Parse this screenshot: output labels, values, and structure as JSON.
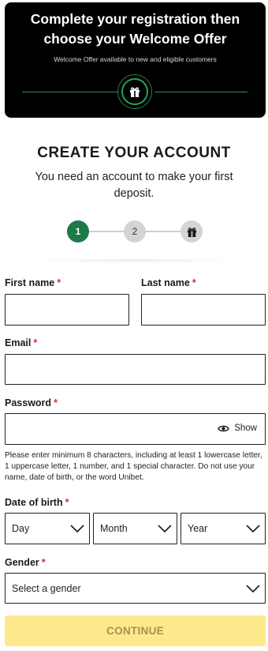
{
  "banner": {
    "title_line1": "Complete your registration then",
    "title_line2": "choose your Welcome Offer",
    "subtitle": "Welcome Offer available to new and eligible customers",
    "icon": "gift-icon",
    "accent_color": "#25a35a"
  },
  "header": {
    "title": "CREATE YOUR ACCOUNT",
    "subtitle": "You need an account to make your first deposit."
  },
  "stepper": {
    "steps": [
      {
        "label": "1",
        "state": "active"
      },
      {
        "label": "2",
        "state": "upcoming"
      },
      {
        "label": "",
        "icon": "gift-icon",
        "state": "upcoming"
      }
    ],
    "active_color": "#1e7a47"
  },
  "form": {
    "first_name": {
      "label": "First name",
      "required": "*",
      "value": "",
      "placeholder": ""
    },
    "last_name": {
      "label": "Last name",
      "required": "*",
      "value": "",
      "placeholder": ""
    },
    "email": {
      "label": "Email",
      "required": "*",
      "value": "",
      "placeholder": ""
    },
    "password": {
      "label": "Password",
      "required": "*",
      "value": "",
      "placeholder": "",
      "show_label": "Show",
      "hint": "Please enter minimum 8 characters, including at least 1 lowercase letter, 1 uppercase letter, 1 number, and 1 special character. Do not use your name, date of birth, or the word Unibet."
    },
    "dob": {
      "label": "Date of birth",
      "required": "*",
      "day": "Day",
      "month": "Month",
      "year": "Year"
    },
    "gender": {
      "label": "Gender",
      "required": "*",
      "value": "Select a gender"
    },
    "continue_label": "CONTINUE",
    "continue_color": "#fde98b",
    "required_color": "#d0312d"
  }
}
